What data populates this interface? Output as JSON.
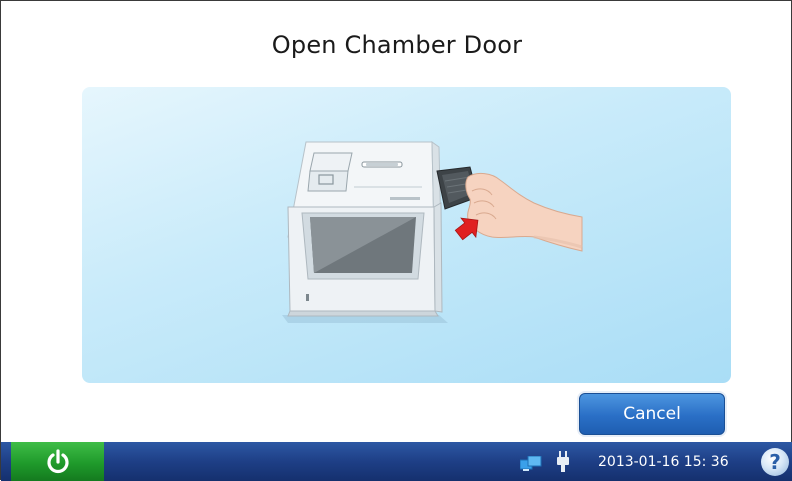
{
  "page": {
    "title": "Open  Chamber Door"
  },
  "illustration": {
    "icon": "analyzer-open-chamber-door-illustration"
  },
  "actions": {
    "cancel_label": "Cancel"
  },
  "taskbar": {
    "power_icon": "power-icon",
    "network_icon": "network-icon",
    "plug_icon": "power-plug-icon",
    "datetime": "2013-01-16  15: 36",
    "help_label": "?"
  },
  "colors": {
    "accent_blue": "#2a6fc6",
    "taskbar_blue": "#1e3f86",
    "power_green": "#1f9a2b",
    "panel_light_blue": "#c9ebfa",
    "arrow_red": "#e02020"
  }
}
